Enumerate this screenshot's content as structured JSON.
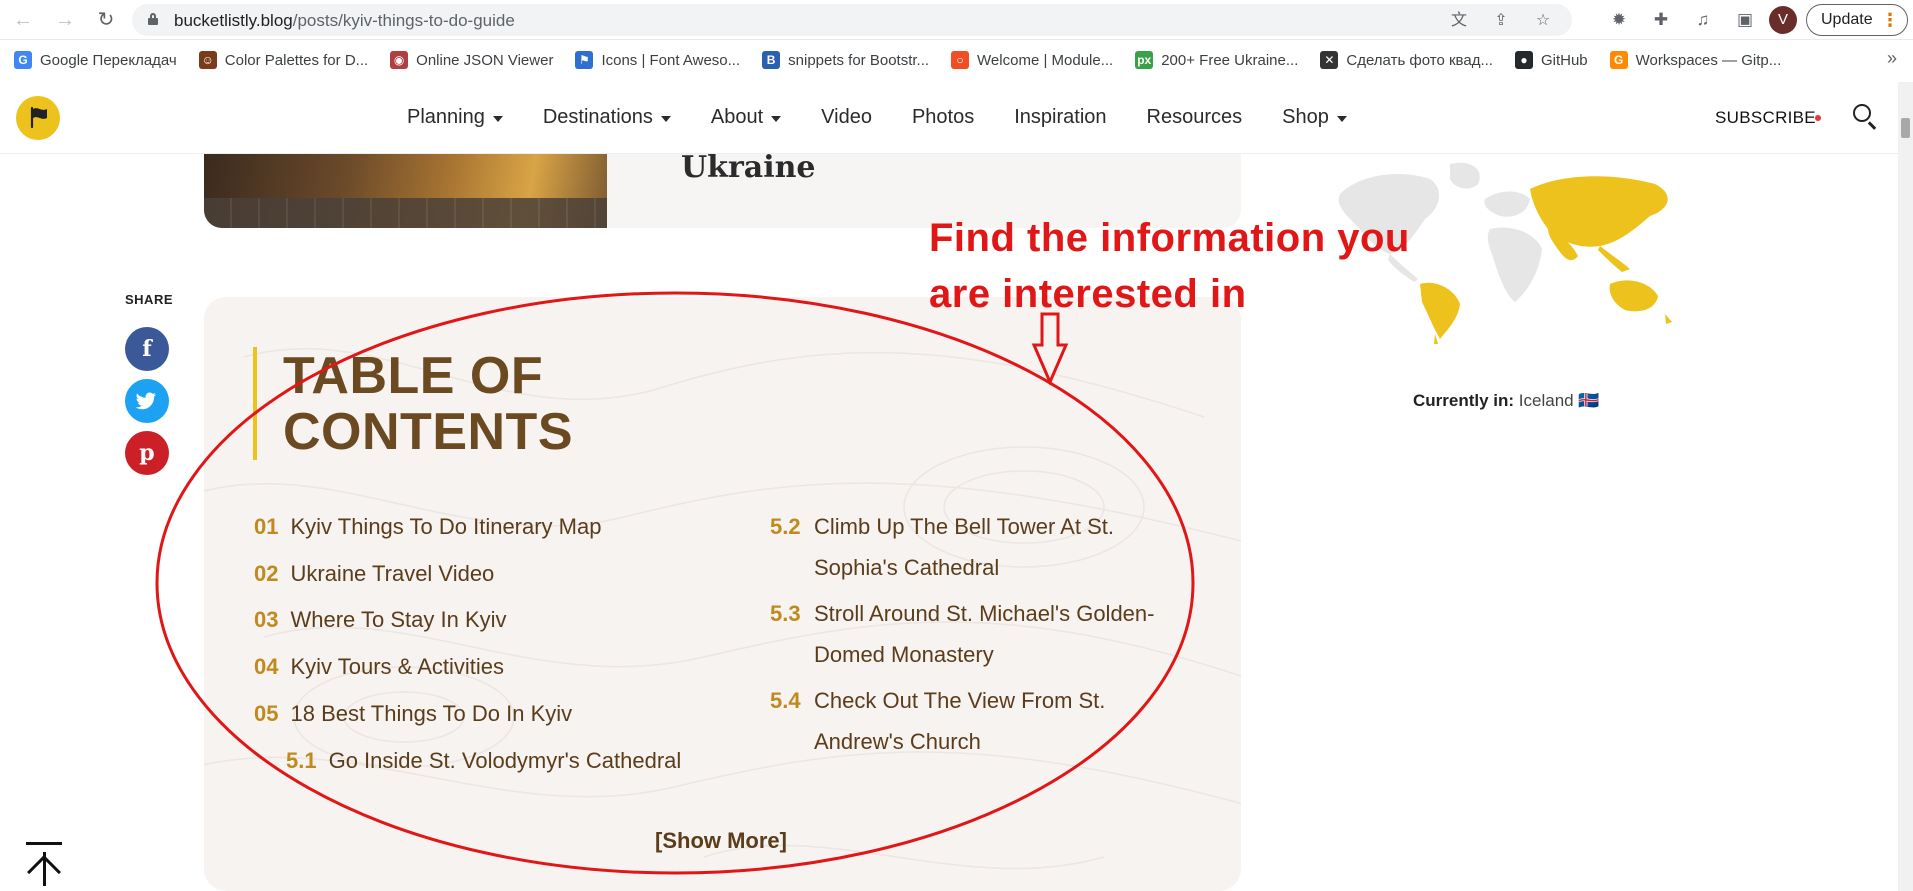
{
  "browser": {
    "url_host": "bucketlistly.blog",
    "url_path": "/posts/kyiv-things-to-do-guide",
    "avatar_letter": "V",
    "update_label": "Update",
    "bookmarks": [
      {
        "label": "Google Перекладач",
        "color": "#4285f4",
        "glyph": "G"
      },
      {
        "label": "Color Palettes for D...",
        "color": "#7a3b1a",
        "glyph": "☺"
      },
      {
        "label": "Online JSON Viewer",
        "color": "#b04040",
        "glyph": "◉"
      },
      {
        "label": "Icons | Font Aweso...",
        "color": "#2f6fd1",
        "glyph": "⚑"
      },
      {
        "label": "snippets for Bootstr...",
        "color": "#2b5fb0",
        "glyph": "B"
      },
      {
        "label": "Welcome | Module...",
        "color": "#f04e23",
        "glyph": "○"
      },
      {
        "label": "200+ Free Ukraine...",
        "color": "#3aa14a",
        "glyph": "px"
      },
      {
        "label": "Сделать фото квад...",
        "color": "#333333",
        "glyph": "✕"
      },
      {
        "label": "GitHub",
        "color": "#24292e",
        "glyph": "●"
      },
      {
        "label": "Workspaces — Gitp...",
        "color": "#ff8a00",
        "glyph": "G"
      }
    ]
  },
  "nav": {
    "items": [
      {
        "label": "Planning",
        "dropdown": true
      },
      {
        "label": "Destinations",
        "dropdown": true
      },
      {
        "label": "About",
        "dropdown": true
      },
      {
        "label": "Video",
        "dropdown": false
      },
      {
        "label": "Photos",
        "dropdown": false
      },
      {
        "label": "Inspiration",
        "dropdown": false
      },
      {
        "label": "Resources",
        "dropdown": false
      },
      {
        "label": "Shop",
        "dropdown": true
      }
    ],
    "subscribe": "SUBSCRIBE"
  },
  "hero": {
    "title": "Ukraine"
  },
  "share": {
    "label": "SHARE"
  },
  "toc": {
    "heading_line1": "TABLE OF",
    "heading_line2": "CONTENTS",
    "left": [
      {
        "num": "01",
        "text": "Kyiv Things To Do Itinerary Map"
      },
      {
        "num": "02",
        "text": "Ukraine Travel Video"
      },
      {
        "num": "03",
        "text": "Where To Stay In Kyiv"
      },
      {
        "num": "04",
        "text": "Kyiv Tours & Activities"
      },
      {
        "num": "05",
        "text": "18 Best Things To Do In Kyiv"
      },
      {
        "num": "5.1",
        "text": "Go Inside St. Volodymyr's Cathedral"
      }
    ],
    "right": [
      {
        "num": "5.2",
        "line1": "Climb Up The Bell Tower At St.",
        "line2": "Sophia's Cathedral"
      },
      {
        "num": "5.3",
        "line1": "Stroll Around St. Michael's Golden-",
        "line2": "Domed Monastery"
      },
      {
        "num": "5.4",
        "line1": "Check Out The View From St.",
        "line2": "Andrew's Church"
      }
    ],
    "show_more": "[Show More]"
  },
  "sidebar": {
    "currently_label": "Currently in:",
    "currently_value": "Iceland 🇮🇸"
  },
  "annotation": {
    "line1": "Find the information you",
    "line2": "are interested in",
    "color": "#e11616"
  }
}
